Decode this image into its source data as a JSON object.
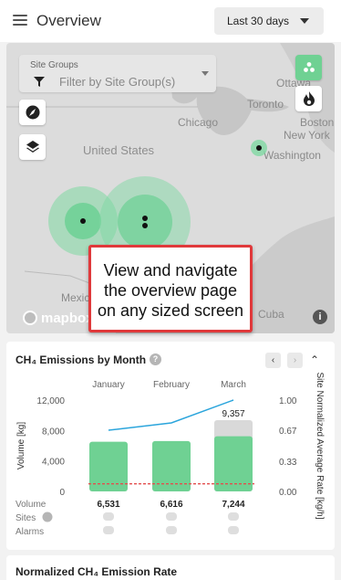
{
  "header": {
    "title": "Overview",
    "date_range": "Last 30 days"
  },
  "map": {
    "filter_label": "Site Groups",
    "filter_placeholder": "Filter by Site Group(s)",
    "labels": [
      "Ottawa",
      "Toronto",
      "Chicago",
      "Boston",
      "New York",
      "Washington",
      "United States",
      "Mexico",
      "Cuba"
    ],
    "attribution": "mapbox",
    "callout_lines": [
      "View and navigate",
      "the overview page",
      "on any sized screen"
    ]
  },
  "emissions_card": {
    "title": "CH₄ Emissions by Month",
    "row_labels": {
      "volume": "Volume",
      "sites": "Sites",
      "alarms": "Alarms"
    },
    "volume_values": [
      "6,531",
      "6,616",
      "7,244"
    ]
  },
  "next_card": {
    "title": "Normalized CH₄ Emission Rate"
  },
  "chart_data": {
    "type": "bar",
    "categories": [
      "January",
      "February",
      "March"
    ],
    "series": [
      {
        "name": "Volume",
        "values": [
          6531,
          6616,
          7244
        ]
      },
      {
        "name": "Site Normalized Average Rate",
        "values": [
          0.67,
          0.75,
          1.0
        ]
      }
    ],
    "highlight": {
      "category": "March",
      "value": 9357,
      "label": "9,357"
    },
    "threshold": 1000,
    "ylabel_left": "Volume [kg]",
    "ylabel_right": "Site Normalized Average Rate [kg/h]",
    "ylim_left": [
      0,
      12000
    ],
    "ylim_right": [
      0,
      1.0
    ],
    "ticks_left": [
      "0",
      "4,000",
      "8,000",
      "12,000"
    ],
    "ticks_right": [
      "0.00",
      "0.33",
      "0.67",
      "1.00"
    ],
    "colors": {
      "bar": "#6fd193",
      "line": "#2ba5dc",
      "threshold": "#e34d4d",
      "highlight_bg": "#d9d9d9"
    }
  }
}
